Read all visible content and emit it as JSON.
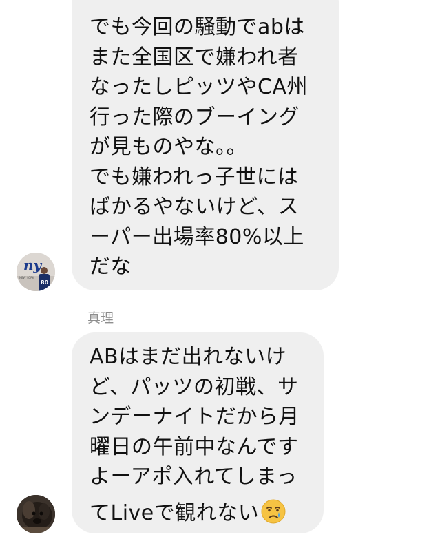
{
  "conversation": {
    "messages": [
      {
        "lines": [
          "でも今回の騒動でabは",
          "また全国区で嫌われ者",
          "なったしピッツやCA州",
          "行った際のブーイング",
          "が見ものやな。。",
          "でも嫌われっ子世には",
          "ばかるやないけど、ス",
          "ーパー出場率80%以上",
          "だな"
        ]
      },
      {
        "sender": "真理",
        "lines": [
          "ABはまだ出れないけ",
          "ど、パッツの初戦、サ",
          "ンデーナイトだから月",
          "曜日の午前中なんです",
          "よーアポ入れてしまっ",
          "てLiveで観れない"
        ],
        "emoji": "crying-face-icon"
      }
    ]
  },
  "colors": {
    "bubble_background": "#efefef",
    "text": "#111111",
    "sender_name": "#8e8e8e"
  }
}
